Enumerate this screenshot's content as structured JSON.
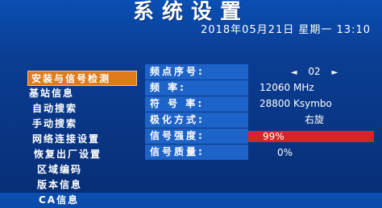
{
  "header": {
    "title": "系统设置",
    "datetime": "2018年05月21日  星期一  13:10"
  },
  "menu": {
    "items": [
      {
        "label": "安装与信号检测",
        "active": true
      },
      {
        "label": "基站信息"
      },
      {
        "label": "自动搜索"
      },
      {
        "label": "手动搜索"
      },
      {
        "label": "网络连接设置"
      },
      {
        "label": "恢复出厂设置"
      },
      {
        "label": "区域编码"
      },
      {
        "label": "版本信息"
      },
      {
        "label": "CA信息"
      }
    ]
  },
  "panel": {
    "freq_index": {
      "label": "频点序号:",
      "value": "02",
      "left_arrow": "◄",
      "right_arrow": "►"
    },
    "frequency": {
      "label": "频      率:",
      "value": "12060 MHz"
    },
    "symbol_rate": {
      "label": "符  号  率:",
      "value": "28800 Ksymbo"
    },
    "polarization": {
      "label": "极化方式:",
      "value": "右旋"
    },
    "signal_strength": {
      "label": "信号强度:",
      "value": "99%",
      "fraction": 0.99
    },
    "signal_quality": {
      "label": "信号质量:",
      "value": "0%",
      "fraction": 0.0
    }
  },
  "colors": {
    "background": "#0b3d92",
    "menu_active": "#e07b1b",
    "label_highlight": "#1e63c8",
    "bar_fill": "#d8232a"
  }
}
